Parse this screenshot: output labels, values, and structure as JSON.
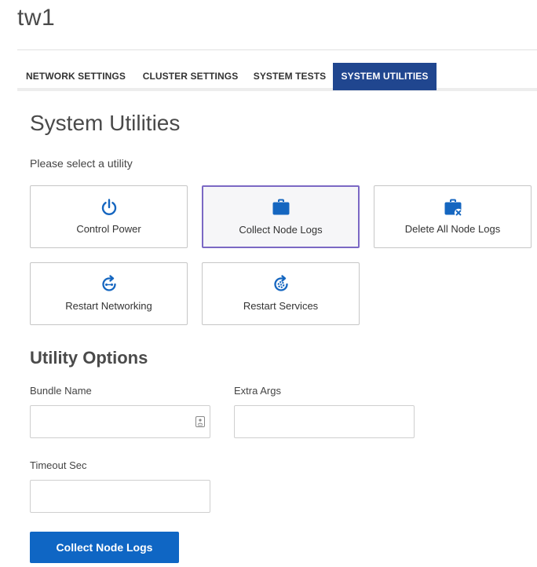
{
  "header": {
    "title": "tw1"
  },
  "tabs": [
    {
      "label": "NETWORK SETTINGS",
      "active": false
    },
    {
      "label": "CLUSTER SETTINGS",
      "active": false
    },
    {
      "label": "SYSTEM TESTS",
      "active": false
    },
    {
      "label": "SYSTEM UTILITIES",
      "active": true
    }
  ],
  "main": {
    "title": "System Utilities",
    "prompt": "Please select a utility",
    "utilities": [
      {
        "label": "Control Power",
        "icon": "power-icon",
        "selected": false
      },
      {
        "label": "Collect Node Logs",
        "icon": "briefcase-icon",
        "selected": true
      },
      {
        "label": "Delete All Node Logs",
        "icon": "briefcase-delete-icon",
        "selected": false
      },
      {
        "label": "Restart Networking",
        "icon": "restart-network-icon",
        "selected": false
      },
      {
        "label": "Restart Services",
        "icon": "restart-services-icon",
        "selected": false
      }
    ]
  },
  "options": {
    "title": "Utility Options",
    "bundle_name": {
      "label": "Bundle Name",
      "value": "",
      "placeholder": ""
    },
    "extra_args": {
      "label": "Extra Args",
      "value": "",
      "placeholder": ""
    },
    "timeout_sec": {
      "label": "Timeout Sec",
      "value": "",
      "placeholder": ""
    },
    "submit_label": "Collect Node Logs"
  },
  "colors": {
    "active_tab": "#20468f",
    "icon": "#1566c0",
    "selected_border": "#7b68c4",
    "primary_button": "#0f66c4"
  }
}
